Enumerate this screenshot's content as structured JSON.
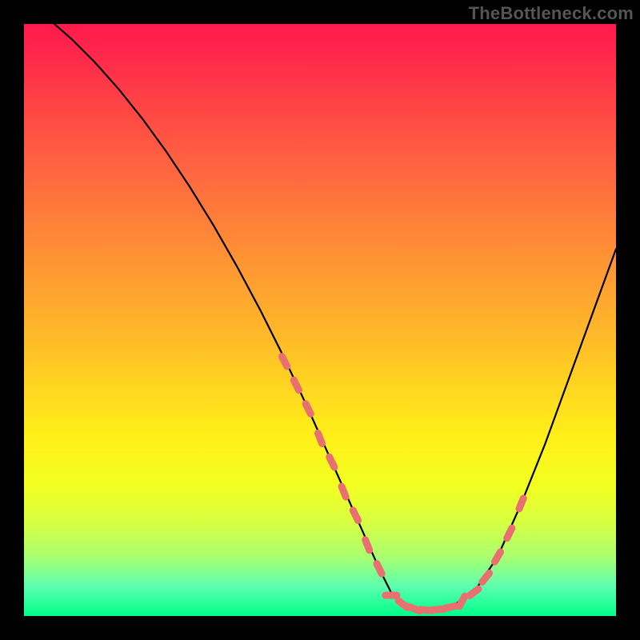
{
  "watermark": "TheBottleneck.com",
  "chart_data": {
    "type": "line",
    "title": "",
    "xlabel": "",
    "ylabel": "",
    "xlim": [
      0,
      100
    ],
    "ylim": [
      0,
      100
    ],
    "series": [
      {
        "name": "bottleneck-curve",
        "x": [
          0,
          4,
          8,
          12,
          16,
          20,
          24,
          28,
          32,
          36,
          40,
          44,
          48,
          52,
          56,
          60,
          62,
          64,
          68,
          72,
          76,
          80,
          84,
          88,
          92,
          96,
          100
        ],
        "y": [
          104,
          101,
          97.5,
          93.5,
          89,
          84,
          78.5,
          72.5,
          66,
          59,
          51.5,
          43.5,
          35,
          26,
          17,
          8,
          4,
          2,
          1,
          1.5,
          4,
          10,
          19,
          29,
          40,
          51,
          62
        ]
      }
    ],
    "markers": {
      "name": "highlight-dots",
      "color": "#e87070",
      "left_cluster": {
        "x": [
          44,
          46,
          48,
          50,
          52,
          54,
          56,
          58,
          60
        ],
        "y": [
          43,
          39,
          35,
          30,
          26,
          21,
          17,
          12,
          8
        ]
      },
      "bottom_cluster": {
        "x": [
          62,
          64,
          66,
          68,
          70,
          72
        ],
        "y": [
          3.5,
          2,
          1.2,
          1,
          1.1,
          1.5
        ]
      },
      "right_cluster": {
        "x": [
          74,
          76,
          78,
          80,
          82,
          84
        ],
        "y": [
          2.5,
          4,
          6.5,
          10,
          14,
          19
        ]
      }
    }
  }
}
